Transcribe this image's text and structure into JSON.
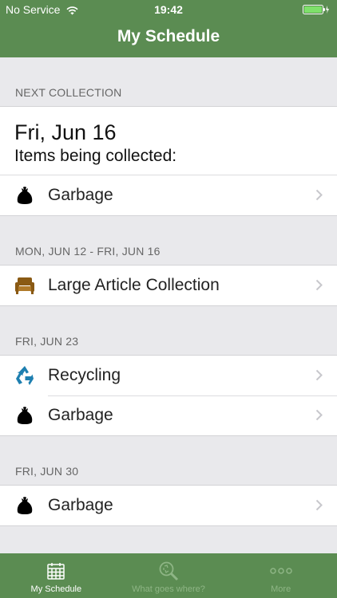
{
  "status_bar": {
    "carrier": "No Service",
    "time": "19:42"
  },
  "nav": {
    "title": "My Schedule"
  },
  "next_collection": {
    "header": "NEXT COLLECTION",
    "date": "Fri, Jun 16",
    "subtitle": "Items being collected:",
    "items": [
      {
        "label": "Garbage",
        "icon": "garbage-bag-icon"
      }
    ]
  },
  "sections": [
    {
      "header": "MON, JUN 12 - FRI, JUN 16",
      "items": [
        {
          "label": "Large Article Collection",
          "icon": "armchair-icon"
        }
      ]
    },
    {
      "header": "FRI, JUN 23",
      "items": [
        {
          "label": "Recycling",
          "icon": "recycling-icon"
        },
        {
          "label": "Garbage",
          "icon": "garbage-bag-icon"
        }
      ]
    },
    {
      "header": "FRI, JUN 30",
      "items": [
        {
          "label": "Garbage",
          "icon": "garbage-bag-icon"
        }
      ]
    }
  ],
  "tabs": [
    {
      "label": "My Schedule",
      "icon": "calendar-icon",
      "active": true
    },
    {
      "label": "What goes where?",
      "icon": "search-recycle-icon",
      "active": false
    },
    {
      "label": "More",
      "icon": "more-dots-icon",
      "active": false
    }
  ],
  "colors": {
    "brand_green": "#5b8c52",
    "recycling_blue": "#1e7fb0",
    "furniture_brown": "#8a5a14"
  }
}
